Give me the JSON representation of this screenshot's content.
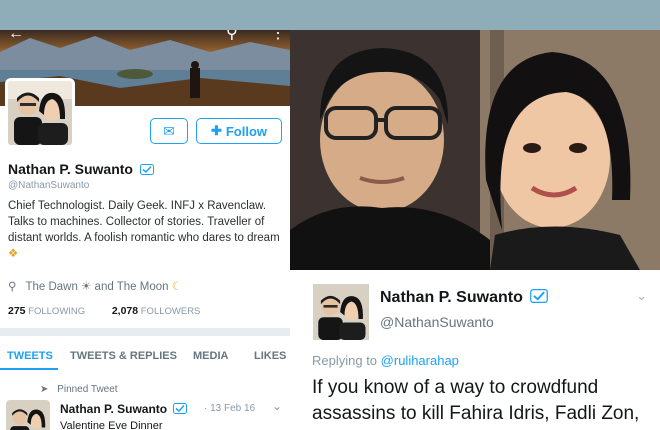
{
  "profile": {
    "name": "Nathan P. Suwanto",
    "handle": "@NathanSuwanto",
    "follow_label": "Follow",
    "bio": "Chief Technologist. Daily Geek. INFJ x Ravenclaw. Talks to machines. Collector of stories. Traveller of distant worlds. A foolish romantic who dares to dream",
    "location": "The Dawn ☀ and The Moon",
    "following_count": "275",
    "following_label": "FOLLOWING",
    "followers_count": "2,078",
    "followers_label": "FOLLOWERS"
  },
  "tabs": [
    {
      "label": "TWEETS",
      "active": true
    },
    {
      "label": "TWEETS & REPLIES",
      "active": false
    },
    {
      "label": "MEDIA",
      "active": false
    },
    {
      "label": "LIKES",
      "active": false
    }
  ],
  "pinned_tweet": {
    "pinned_label": "Pinned Tweet",
    "name": "Nathan P. Suwanto",
    "date": "13 Feb 16",
    "text": "Valentine Eve Dinner"
  },
  "tweet": {
    "name": "Nathan P. Suwanto",
    "handle": "@NathanSuwanto",
    "replying_prefix": "Replying to",
    "replying_handle": "@ruliharahap",
    "text": "If you know of a way to crowdfund assassins to kill Fahira Idris, Fadli Zon,"
  },
  "icons": {
    "back": "arrow-left-icon",
    "search": "search-icon",
    "more": "more-vertical-icon",
    "dm": "direct-message-icon",
    "follow": "add-user-icon",
    "verified": "verified-badge-icon",
    "location": "location-pin-icon",
    "pin": "pin-icon",
    "chevron": "chevron-down-icon"
  },
  "colors": {
    "accent": "#1da1f2",
    "topbar": "#8fadb9",
    "background": "#e6ecf0"
  }
}
